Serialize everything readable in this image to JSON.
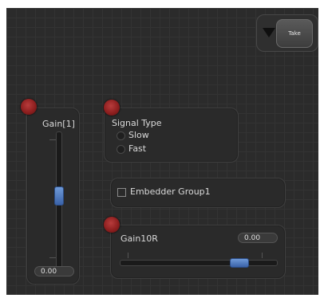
{
  "take": {
    "label": "Take"
  },
  "gain1": {
    "title": "Gain[1]",
    "value": "0.00",
    "level": 0.55
  },
  "signal_type": {
    "title": "Signal Type",
    "options": [
      "Slow",
      "Fast"
    ]
  },
  "embedder": {
    "label": "Embedder Group1"
  },
  "gain10r": {
    "title": "Gain10R",
    "value": "0.00",
    "level": 0.75
  },
  "colors": {
    "background": "#2b2b2b",
    "led": "#8e1f1f",
    "thumb": "#4a74bd"
  }
}
